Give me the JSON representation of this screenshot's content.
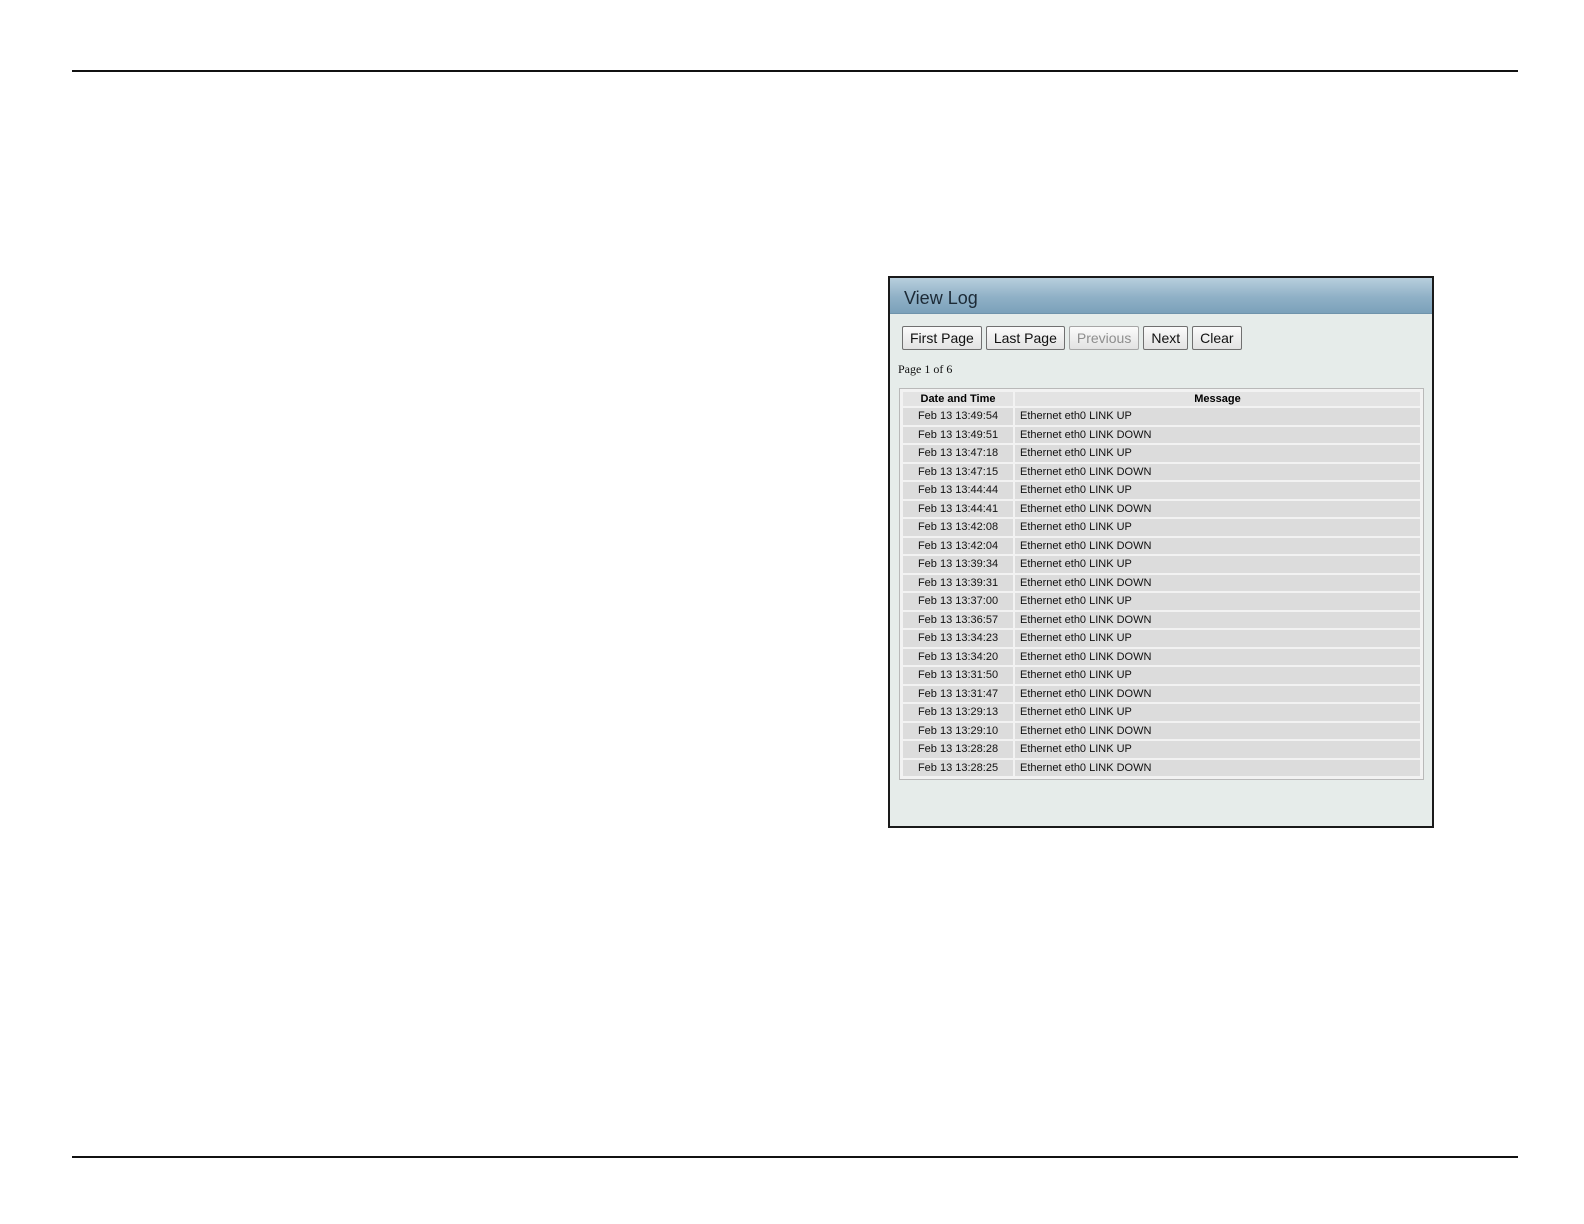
{
  "panel": {
    "title": "View Log"
  },
  "toolbar": {
    "first_page_label": "First Page",
    "last_page_label": "Last Page",
    "previous_label": "Previous",
    "next_label": "Next",
    "clear_label": "Clear"
  },
  "pagination": {
    "text": "Page 1 of 6"
  },
  "log_table": {
    "headers": [
      "Date and Time",
      "Message"
    ],
    "rows": [
      {
        "datetime": "Feb 13 13:49:54",
        "message": "Ethernet eth0 LINK UP"
      },
      {
        "datetime": "Feb 13 13:49:51",
        "message": "Ethernet eth0 LINK DOWN"
      },
      {
        "datetime": "Feb 13 13:47:18",
        "message": "Ethernet eth0 LINK UP"
      },
      {
        "datetime": "Feb 13 13:47:15",
        "message": "Ethernet eth0 LINK DOWN"
      },
      {
        "datetime": "Feb 13 13:44:44",
        "message": "Ethernet eth0 LINK UP"
      },
      {
        "datetime": "Feb 13 13:44:41",
        "message": "Ethernet eth0 LINK DOWN"
      },
      {
        "datetime": "Feb 13 13:42:08",
        "message": "Ethernet eth0 LINK UP"
      },
      {
        "datetime": "Feb 13 13:42:04",
        "message": "Ethernet eth0 LINK DOWN"
      },
      {
        "datetime": "Feb 13 13:39:34",
        "message": "Ethernet eth0 LINK UP"
      },
      {
        "datetime": "Feb 13 13:39:31",
        "message": "Ethernet eth0 LINK DOWN"
      },
      {
        "datetime": "Feb 13 13:37:00",
        "message": "Ethernet eth0 LINK UP"
      },
      {
        "datetime": "Feb 13 13:36:57",
        "message": "Ethernet eth0 LINK DOWN"
      },
      {
        "datetime": "Feb 13 13:34:23",
        "message": "Ethernet eth0 LINK UP"
      },
      {
        "datetime": "Feb 13 13:34:20",
        "message": "Ethernet eth0 LINK DOWN"
      },
      {
        "datetime": "Feb 13 13:31:50",
        "message": "Ethernet eth0 LINK UP"
      },
      {
        "datetime": "Feb 13 13:31:47",
        "message": "Ethernet eth0 LINK DOWN"
      },
      {
        "datetime": "Feb 13 13:29:13",
        "message": "Ethernet eth0 LINK UP"
      },
      {
        "datetime": "Feb 13 13:29:10",
        "message": "Ethernet eth0 LINK DOWN"
      },
      {
        "datetime": "Feb 13 13:28:28",
        "message": "Ethernet eth0 LINK UP"
      },
      {
        "datetime": "Feb 13 13:28:25",
        "message": "Ethernet eth0 LINK DOWN"
      }
    ]
  },
  "colors": {
    "header_gradient_top": "#b8cfdd",
    "header_gradient_bottom": "#7ba1ba",
    "panel_background": "#e6ecea",
    "row_background": "#dcdcdc"
  }
}
